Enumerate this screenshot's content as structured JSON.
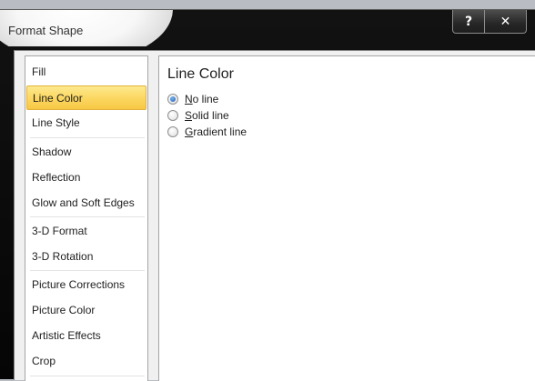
{
  "window": {
    "title": "Format Shape",
    "help_label": "?",
    "close_label": "✕"
  },
  "sidebar": {
    "selected": "Line Color",
    "items": [
      {
        "label": "Fill"
      },
      {
        "label": "Line Color"
      },
      {
        "label": "Line Style"
      },
      {
        "label": "Shadow"
      },
      {
        "label": "Reflection"
      },
      {
        "label": "Glow and Soft Edges"
      },
      {
        "label": "3-D Format"
      },
      {
        "label": "3-D Rotation"
      },
      {
        "label": "Picture Corrections"
      },
      {
        "label": "Picture Color"
      },
      {
        "label": "Artistic Effects"
      },
      {
        "label": "Crop"
      }
    ]
  },
  "panel": {
    "title": "Line Color",
    "options": [
      {
        "mnemonic": "N",
        "rest": "o line",
        "checked": true
      },
      {
        "mnemonic": "S",
        "rest": "olid line",
        "checked": false
      },
      {
        "mnemonic": "G",
        "rest": "radient line",
        "checked": false
      }
    ]
  }
}
